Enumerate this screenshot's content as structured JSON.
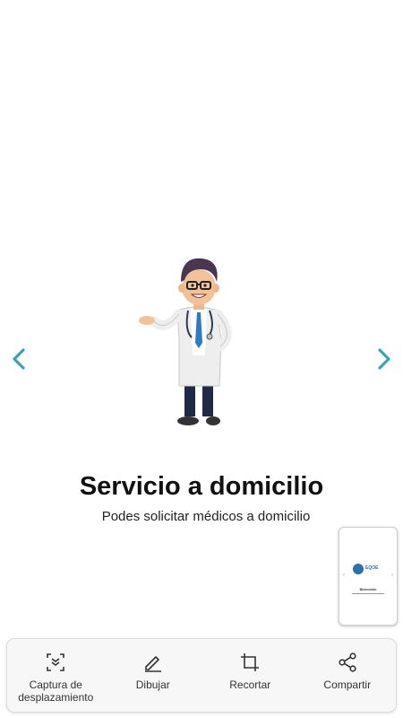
{
  "slide": {
    "title": "Servicio a domicilio",
    "subtitle": "Podes solicitar médicos a domicilio"
  },
  "thumbnail": {
    "brand": "EQOE",
    "welcome": "Bienvenido"
  },
  "toolbar": {
    "scroll_capture": "Captura de desplazamiento",
    "draw": "Dibujar",
    "crop": "Recortar",
    "share": "Compartir"
  },
  "colors": {
    "arrow": "#3aa4b2",
    "doctor_coat": "#eeeeee",
    "doctor_tie": "#2d79c7"
  },
  "icons": [
    "chevron-left-icon",
    "chevron-right-icon",
    "scroll-capture-icon",
    "pencil-icon",
    "crop-icon",
    "share-icon"
  ]
}
